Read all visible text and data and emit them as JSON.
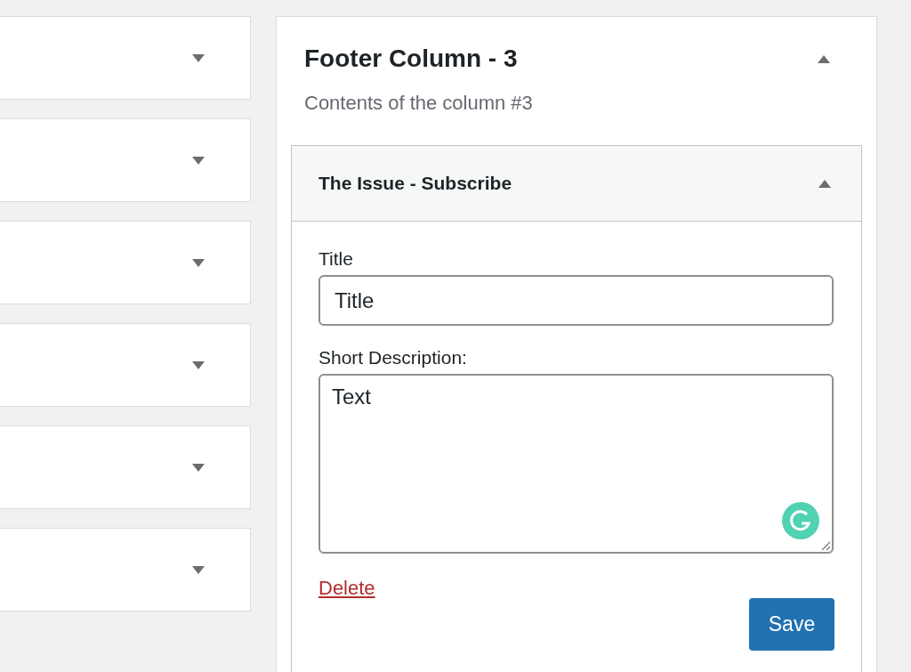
{
  "left_widgets": [
    {
      "expanded": false
    },
    {
      "expanded": false
    },
    {
      "expanded": false
    },
    {
      "expanded": false
    },
    {
      "expanded": false
    },
    {
      "expanded": false
    }
  ],
  "sidebar_panel": {
    "title": "Footer Column - 3",
    "expanded": true,
    "description": "Contents of the column #3",
    "widget": {
      "title": "The Issue - Subscribe",
      "expanded": true,
      "fields": [
        {
          "kind": "input",
          "label": "Title",
          "value": "Title"
        },
        {
          "kind": "textarea",
          "label": "Short Description:",
          "value": "Text"
        }
      ],
      "delete_link": "Delete",
      "save_button": "Save"
    }
  }
}
